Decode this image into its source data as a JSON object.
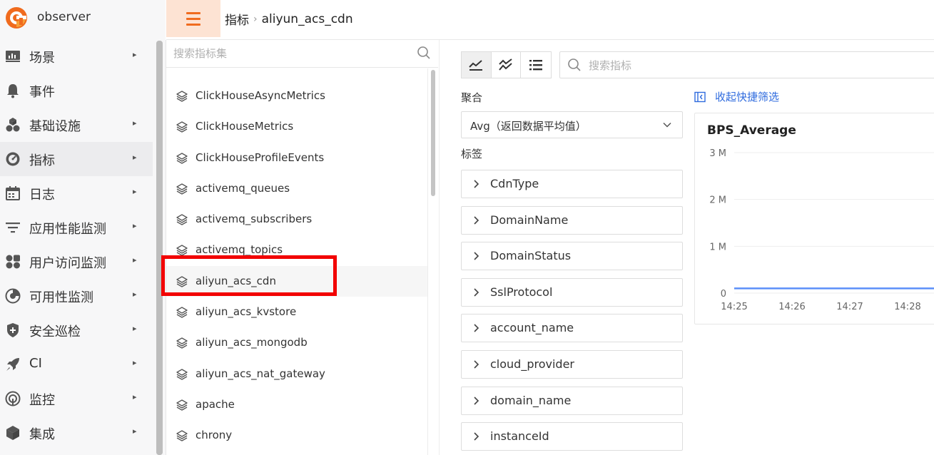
{
  "app": {
    "name": "observer"
  },
  "colors": {
    "accent": "#f06b1e",
    "link": "#2f6bde",
    "highlight": "#f20000",
    "series": "#5b8ff9"
  },
  "sidebar": {
    "items": [
      {
        "label": "场景",
        "icon": "dashboard-icon",
        "has_arrow": true
      },
      {
        "label": "事件",
        "icon": "bell-icon",
        "has_arrow": false
      },
      {
        "label": "基础设施",
        "icon": "cubes-icon",
        "has_arrow": true
      },
      {
        "label": "指标",
        "icon": "gauge-icon",
        "has_arrow": true,
        "active": true
      },
      {
        "label": "日志",
        "icon": "calendar-icon",
        "has_arrow": true
      },
      {
        "label": "应用性能监测",
        "icon": "filter-icon",
        "has_arrow": true
      },
      {
        "label": "用户访问监测",
        "icon": "grid-icon",
        "has_arrow": true
      },
      {
        "label": "可用性监测",
        "icon": "radar-icon",
        "has_arrow": true
      },
      {
        "label": "安全巡检",
        "icon": "shield-icon",
        "has_arrow": true
      },
      {
        "label": "CI",
        "icon": "rocket-icon",
        "has_arrow": true
      },
      {
        "label": "监控",
        "icon": "target-icon",
        "has_arrow": true
      },
      {
        "label": "集成",
        "icon": "box-icon",
        "has_arrow": true
      }
    ]
  },
  "breadcrumb": {
    "parent": "指标",
    "separator": "›",
    "current": "aliyun_acs_cdn"
  },
  "metric_sets": {
    "search_placeholder": "搜索指标集",
    "items": [
      "ClickHouseAsyncMetrics",
      "ClickHouseMetrics",
      "ClickHouseProfileEvents",
      "activemq_queues",
      "activemq_subscribers",
      "activemq_topics",
      "aliyun_acs_cdn",
      "aliyun_acs_kvstore",
      "aliyun_acs_mongodb",
      "aliyun_acs_nat_gateway",
      "apache",
      "chrony"
    ],
    "selected": "aliyun_acs_cdn"
  },
  "metric_search": {
    "placeholder": "搜索指标"
  },
  "aggregation": {
    "label": "聚合",
    "value": "Avg（返回数据平均值）"
  },
  "tags": {
    "label": "标签",
    "items": [
      "CdnType",
      "DomainName",
      "DomainStatus",
      "SslProtocol",
      "account_name",
      "cloud_provider",
      "domain_name",
      "instanceId"
    ]
  },
  "collapse_filter": {
    "label": "收起快捷筛选"
  },
  "chart_data": {
    "type": "line",
    "title": "BPS_Average",
    "x": [
      "14:25",
      "14:26",
      "14:27",
      "14:28"
    ],
    "series": [
      {
        "values": [
          100000,
          100000,
          100000,
          100000
        ]
      }
    ],
    "yticks": [
      "0",
      "1 M",
      "2 M",
      "3 M"
    ],
    "ylim": [
      0,
      3000000
    ],
    "grid": true
  }
}
